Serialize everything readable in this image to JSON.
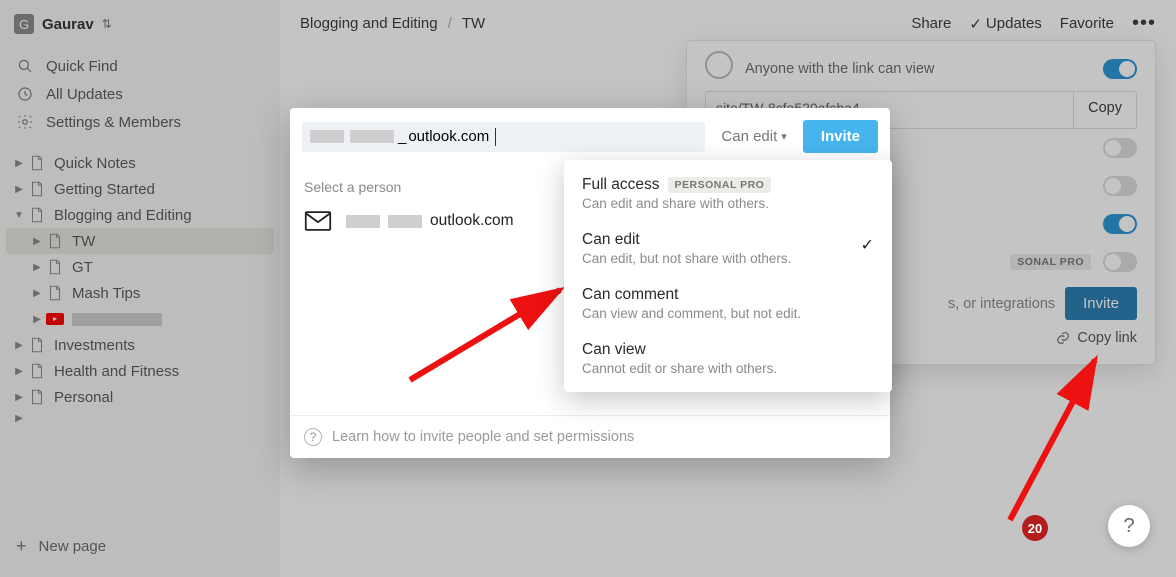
{
  "workspace": {
    "avatar_letter": "G",
    "name": "Gaurav"
  },
  "nav": {
    "quick_find": "Quick Find",
    "all_updates": "All Updates",
    "settings": "Settings & Members"
  },
  "pages": {
    "quick_notes": "Quick Notes",
    "getting_started": "Getting Started",
    "blogging": "Blogging and Editing",
    "tw": "TW",
    "gt": "GT",
    "mash_tips": "Mash Tips",
    "investments": "Investments",
    "health": "Health and Fitness",
    "personal": "Personal"
  },
  "new_page": "New page",
  "breadcrumbs": {
    "parent": "Blogging and Editing",
    "current": "TW"
  },
  "top_actions": {
    "share": "Share",
    "updates": "Updates",
    "favorite": "Favorite"
  },
  "share_panel": {
    "anyone": "Anyone with the link can view",
    "url": "site/TW-8cfa520afcba4",
    "copy": "Copy",
    "pro_badge": "SONAL PRO",
    "invite_hint": "s, or integrations",
    "invite": "Invite",
    "copy_link": "Copy link"
  },
  "invite_modal": {
    "input_suffix": "outlook.com",
    "perm_label": "Can edit",
    "invite_btn": "Invite",
    "select_label": "Select a person",
    "person_email_suffix": "outlook.com",
    "footer": "Learn how to invite people and set permissions"
  },
  "perm_options": {
    "full_access": {
      "title": "Full access",
      "badge": "PERSONAL PRO",
      "desc": "Can edit and share with others."
    },
    "can_edit": {
      "title": "Can edit",
      "desc": "Can edit, but not share with others."
    },
    "can_comment": {
      "title": "Can comment",
      "desc": "Can view and comment, but not edit."
    },
    "can_view": {
      "title": "Can view",
      "desc": "Cannot edit or share with others."
    }
  },
  "badges": {
    "red_count": "20"
  },
  "help_fab": "?"
}
